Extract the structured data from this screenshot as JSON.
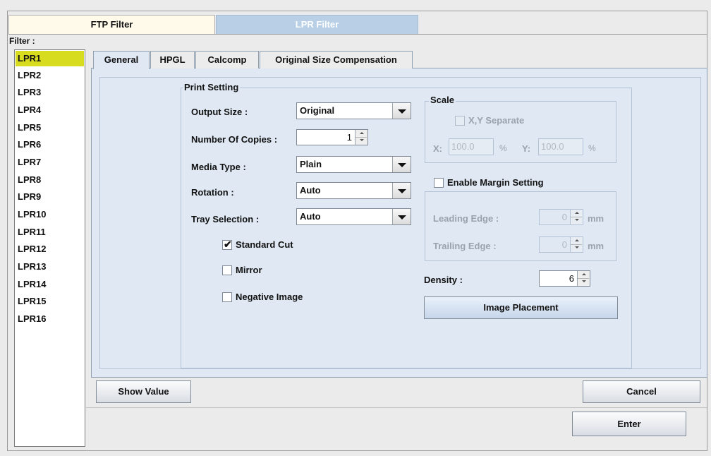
{
  "top_tabs": {
    "ftp": "FTP Filter",
    "lpr": "LPR Filter"
  },
  "filter_label": "Filter :",
  "filter_list": [
    "LPR1",
    "LPR2",
    "LPR3",
    "LPR4",
    "LPR5",
    "LPR6",
    "LPR7",
    "LPR8",
    "LPR9",
    "LPR10",
    "LPR11",
    "LPR12",
    "LPR13",
    "LPR14",
    "LPR15",
    "LPR16"
  ],
  "selected_filter": "LPR1",
  "sub_tabs": [
    "General",
    "HPGL",
    "Calcomp",
    "Original Size Compensation"
  ],
  "active_sub_tab": "General",
  "print_setting": {
    "title": "Print Setting",
    "output_size_label": "Output Size :",
    "output_size_value": "Original",
    "copies_label": "Number Of Copies :",
    "copies_value": "1",
    "media_type_label": "Media Type :",
    "media_type_value": "Plain",
    "rotation_label": "Rotation :",
    "rotation_value": "Auto",
    "tray_label": "Tray Selection :",
    "tray_value": "Auto",
    "standard_cut_label": "Standard Cut",
    "standard_cut_checked": true,
    "mirror_label": "Mirror",
    "mirror_checked": false,
    "negative_label": "Negative Image",
    "negative_checked": false
  },
  "scale": {
    "title": "Scale",
    "xy_separate_label": "X,Y Separate",
    "x_label": "X:",
    "x_value": "100.0",
    "y_label": "Y:",
    "y_value": "100.0",
    "unit": "%"
  },
  "margin": {
    "enable_label": "Enable Margin Setting",
    "leading_label": "Leading Edge :",
    "leading_value": "0",
    "trailing_label": "Trailing Edge :",
    "trailing_value": "0",
    "unit": "mm"
  },
  "density_label": "Density :",
  "density_value": "6",
  "buttons": {
    "image_placement": "Image Placement",
    "show_value": "Show Value",
    "cancel": "Cancel",
    "enter": "Enter"
  },
  "colors": {
    "selected_item": "#d7dc1e",
    "panel_bg": "#dfe8f3",
    "lpr_tab": "#b8cfe5",
    "ftp_tab": "#fffaea"
  }
}
